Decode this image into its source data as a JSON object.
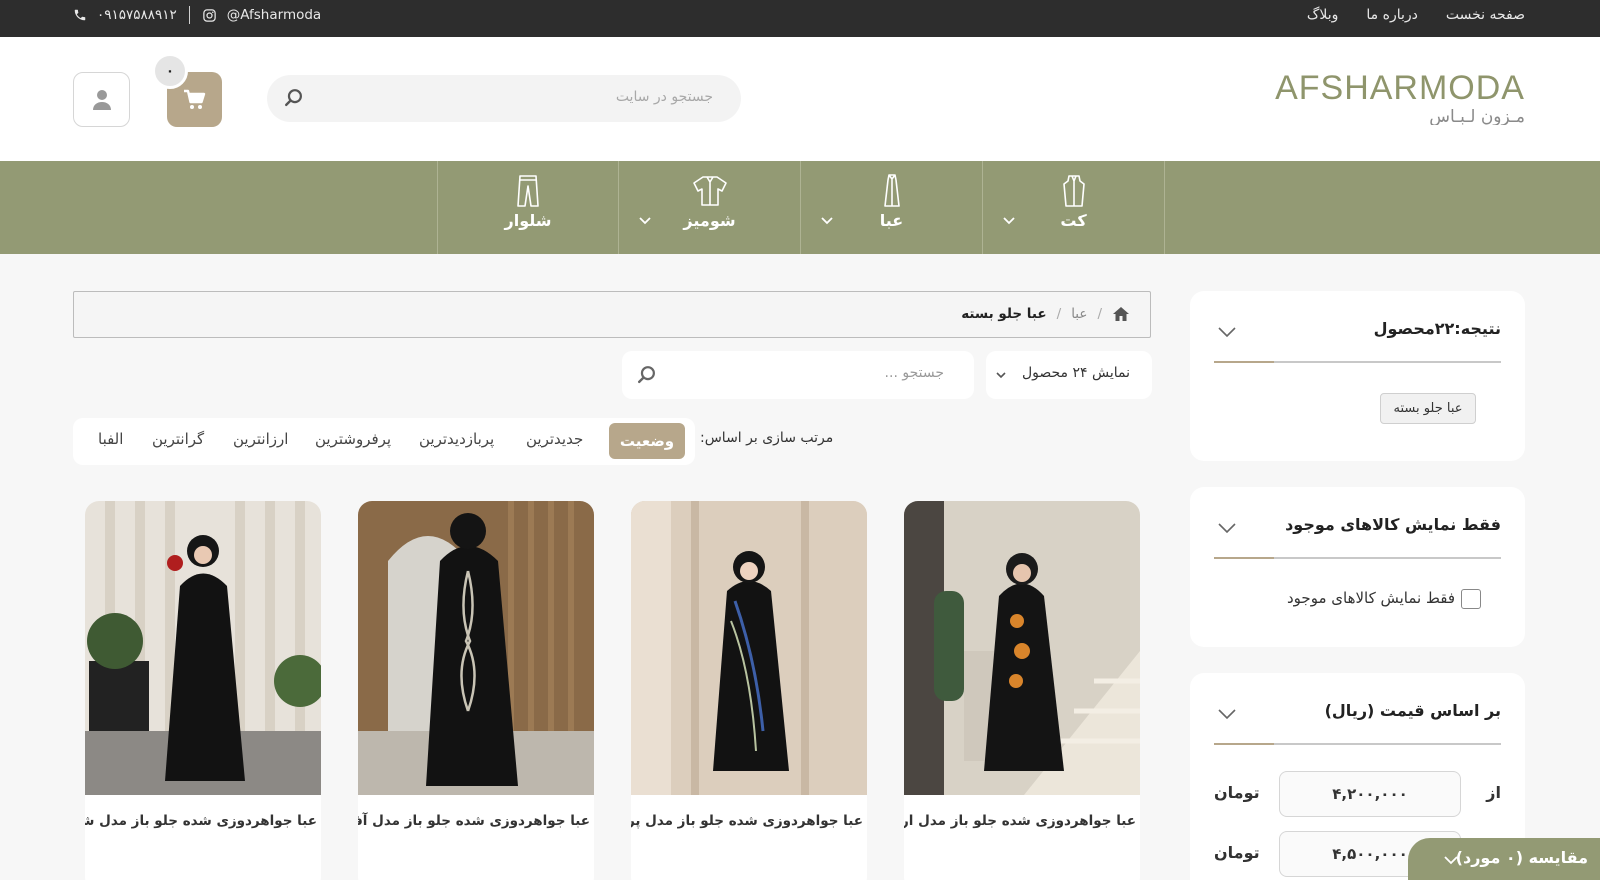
{
  "topbar": {
    "nav": [
      "صفحه نخست",
      "درباره ما",
      "وبلاگ"
    ],
    "instagram": "@Afsharmoda",
    "phone": "۰۹۱۵۷۵۸۸۹۱۲"
  },
  "header": {
    "logo_main": "AFSHARMODA",
    "logo_sub": "مـزون لـبـاس",
    "search_placeholder": "جستجو در سایت",
    "cart_count": "۰"
  },
  "categories": [
    {
      "label": "کت",
      "icon": "jacket-icon",
      "has_dropdown": true
    },
    {
      "label": "عبا",
      "icon": "abaya-icon",
      "has_dropdown": true
    },
    {
      "label": "شومیز",
      "icon": "blouse-icon",
      "has_dropdown": true
    },
    {
      "label": "شلوار",
      "icon": "pants-icon",
      "has_dropdown": false
    }
  ],
  "breadcrumb": {
    "home_icon": "home-icon",
    "items": [
      "عبا",
      "عبا جلو بسته"
    ]
  },
  "listing": {
    "per_page": "نمایش ۲۴ محصول",
    "search_placeholder": "جستجو ...",
    "sort_label": "مرتب سازی بر اساس:",
    "sort_active": "وضعیت",
    "sort_options": [
      "جدیدترین",
      "پربازدیدترین",
      "پرفروشترین",
      "ارزانترین",
      "گرانترین",
      "الفبا"
    ]
  },
  "products": [
    {
      "title": "عبا جواهردوزی شده جلو باز مدل ارکیده",
      "accent": "#d9852b"
    },
    {
      "title": "عبا جواهردوزی شده جلو باز مدل پرمیلا",
      "accent": "#3d5fa8"
    },
    {
      "title": "عبا جواهردوزی شده جلو باز مدل آفاق",
      "accent": "#c9c4b5"
    },
    {
      "title": "عبا جواهردوزی شده جلو باز مدل شبنم",
      "accent": "#b01e1e"
    }
  ],
  "sidebar": {
    "result_title": "نتیجه:۲۲محصول",
    "result_tag": "عبا جلو بسته",
    "stock_title": "فقط نمایش کالاهای موجود",
    "stock_checkbox": "فقط نمایش کالاهای موجود",
    "price_title": "بر اساس قیمت (ریال)",
    "price_from_label": "از",
    "price_from": "۴,۲۰۰,۰۰۰",
    "price_to": "۴,۵۰۰,۰۰۰",
    "price_unit": "تومان"
  },
  "compare": {
    "label": "مقایسه (۰ مورد)"
  },
  "colors": {
    "accent": "#939a74",
    "beige": "#b7a78b",
    "topbar": "#2d2d2d"
  }
}
